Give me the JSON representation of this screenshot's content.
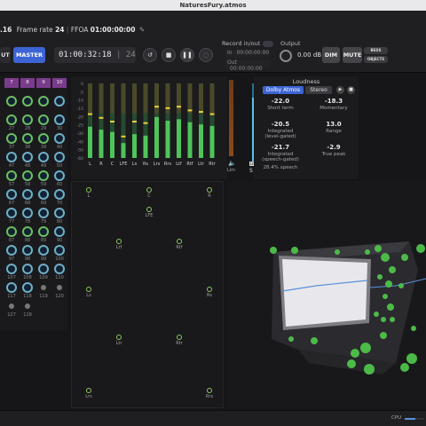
{
  "window": {
    "title": "NaturesFury.atmos"
  },
  "info": {
    "fps_tail": ".16",
    "frame_rate_label": "Frame rate",
    "frame_rate_value": "24",
    "ffoa_label": "FFOA",
    "ffoa_value": "01:00:00:00",
    "edit_icon": "pencil-icon"
  },
  "toolbar": {
    "input_label": "UT",
    "master_label": "MASTER",
    "timecode": "01:00:32:18",
    "timecode_frames": "24",
    "record_label": "Record in/out",
    "in_label": "In",
    "in_value": "00:00:00:00",
    "out_label": "Out",
    "out_value": "00:00:00:00",
    "output_label": "Output",
    "output_value": "0.00",
    "output_unit": "dB",
    "dim_label": "DIM",
    "mute_label": "MUTE",
    "bed_label": "BEDS",
    "objects_label": "OBJECTS",
    "history_icon": "history-icon",
    "stop_icon": "stop-icon",
    "pause_icon": "pause-icon",
    "loop_icon": "loop-icon",
    "knob_icon": "output-knob-icon"
  },
  "object_grid": {
    "header": [
      "7",
      "8",
      "9",
      "10"
    ],
    "rows": [
      [
        "",
        "",
        "",
        ""
      ],
      [
        "27",
        "28",
        "29",
        "30"
      ],
      [
        "37",
        "38",
        "39",
        "40"
      ],
      [
        "47",
        "48",
        "49",
        "50"
      ],
      [
        "57",
        "58",
        "59",
        "60"
      ],
      [
        "67",
        "68",
        "69",
        "70"
      ],
      [
        "77",
        "78",
        "79",
        "80"
      ],
      [
        "87",
        "88",
        "89",
        "90"
      ],
      [
        "97",
        "98",
        "99",
        "100"
      ],
      [
        "107",
        "108",
        "109",
        "110"
      ],
      [
        "117",
        "118",
        "119",
        "120"
      ],
      [
        "127",
        "128",
        "",
        ""
      ]
    ],
    "active_color": "#6dbf62",
    "object_color": "#6fb0c8",
    "header_color": "#7a3b8c"
  },
  "meters": {
    "scale": [
      "0",
      "-5",
      "-10",
      "-15",
      "-20",
      "-25",
      "-30",
      "-40",
      "-50",
      "-60"
    ],
    "channels": [
      "L",
      "R",
      "C",
      "LFE",
      "Ls",
      "Rs",
      "Lrs",
      "Rrs",
      "Ltf",
      "Rtf",
      "Ltr",
      "Rtr"
    ],
    "levels": [
      0.42,
      0.38,
      0.35,
      0.2,
      0.32,
      0.3,
      0.55,
      0.5,
      0.52,
      0.48,
      0.45,
      0.43
    ],
    "peaks": [
      0.6,
      0.55,
      0.5,
      0.3,
      0.5,
      0.48,
      0.7,
      0.68,
      0.7,
      0.65,
      0.63,
      0.6
    ],
    "lim_label": "Lim",
    "lfe_label": "LFE",
    "s_label": "S",
    "m_label": "M",
    "speaker_icon": "speaker-icon"
  },
  "loudness": {
    "title": "Loudness",
    "mode_active": "Dolby Atmos",
    "mode_other": "Stereo",
    "play_icon": "play-icon",
    "stop_icon": "stop-icon",
    "values": [
      {
        "value": "-22.0",
        "label": "Short term"
      },
      {
        "value": "-18.3",
        "label": "Momentary"
      },
      {
        "value": "-20.5",
        "label": "Integrated\n(level-gated)"
      },
      {
        "value": "13.0",
        "label": "Range"
      },
      {
        "value": "-21.7",
        "label": "Integrated\n(speech-gated)"
      },
      {
        "value": "-2.9",
        "label": "True peak"
      }
    ],
    "speech": "28.4% speech"
  },
  "panner2d": {
    "speakers": [
      "L",
      "C",
      "R",
      "LFE",
      "Lrf",
      "Rtf",
      "Ls",
      "Rs",
      "Ltr",
      "Rtr",
      "Lrs",
      "Rrs"
    ]
  },
  "panner3d": {
    "accent": "#5b8fd8"
  },
  "status": {
    "cpu_label": "CPU",
    "cpu_level": 0.55
  }
}
